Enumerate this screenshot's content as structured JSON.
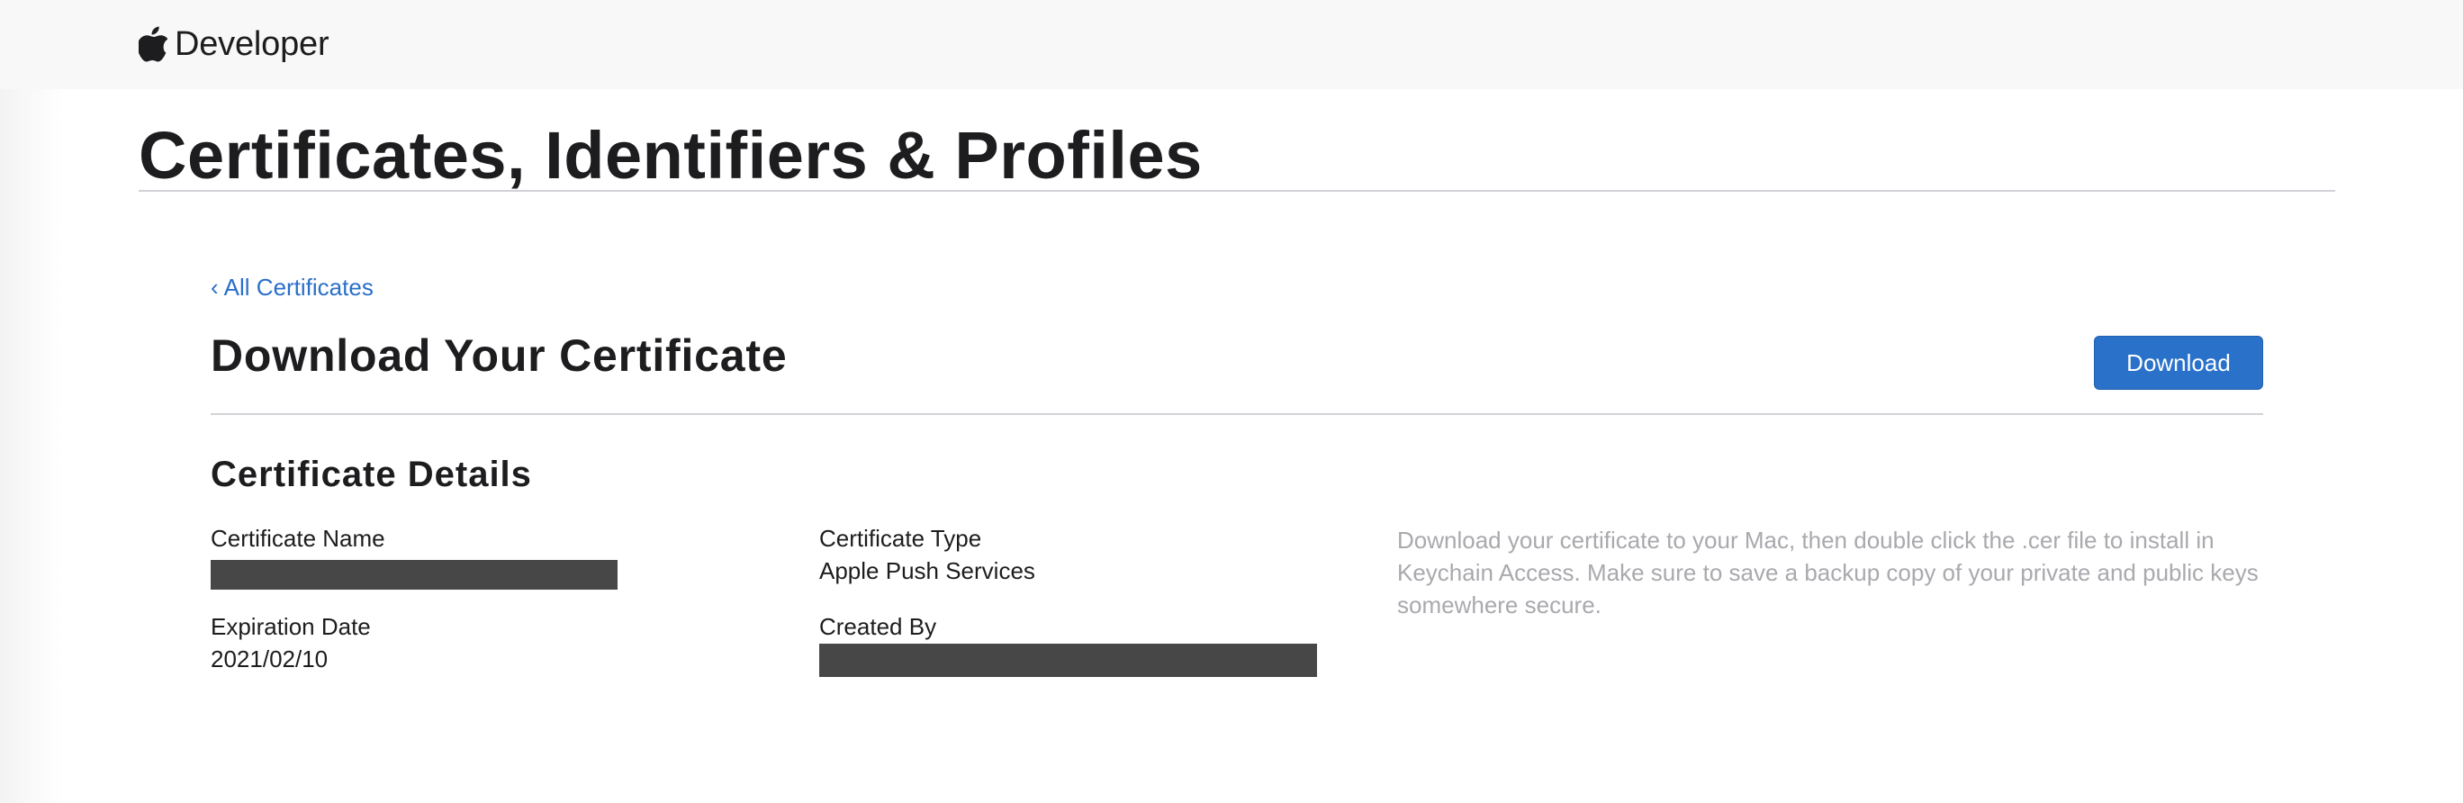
{
  "header": {
    "brand_text": "Developer",
    "brand_icon": "apple-logo-icon"
  },
  "page": {
    "title": "Certificates, Identifiers & Profiles"
  },
  "nav": {
    "back_chevron": "‹",
    "back_label": "All Certificates"
  },
  "main": {
    "title": "Download Your Certificate",
    "download_label": "Download",
    "details_title": "Certificate Details",
    "fields": {
      "certificate_name_label": "Certificate Name",
      "certificate_type_label": "Certificate Type",
      "certificate_type_value": "Apple Push Services",
      "expiration_date_label": "Expiration Date",
      "expiration_date_value": "2021/02/10",
      "created_by_label": "Created By"
    },
    "help_text": "Download your certificate to your Mac, then double click the .cer file to install in Keychain Access. Make sure to save a backup copy of your private and public keys somewhere secure."
  },
  "colors": {
    "accent": "#2a72c9",
    "link": "#2a6fc9",
    "redaction": "#474747",
    "muted_text": "#a9a9ae"
  }
}
